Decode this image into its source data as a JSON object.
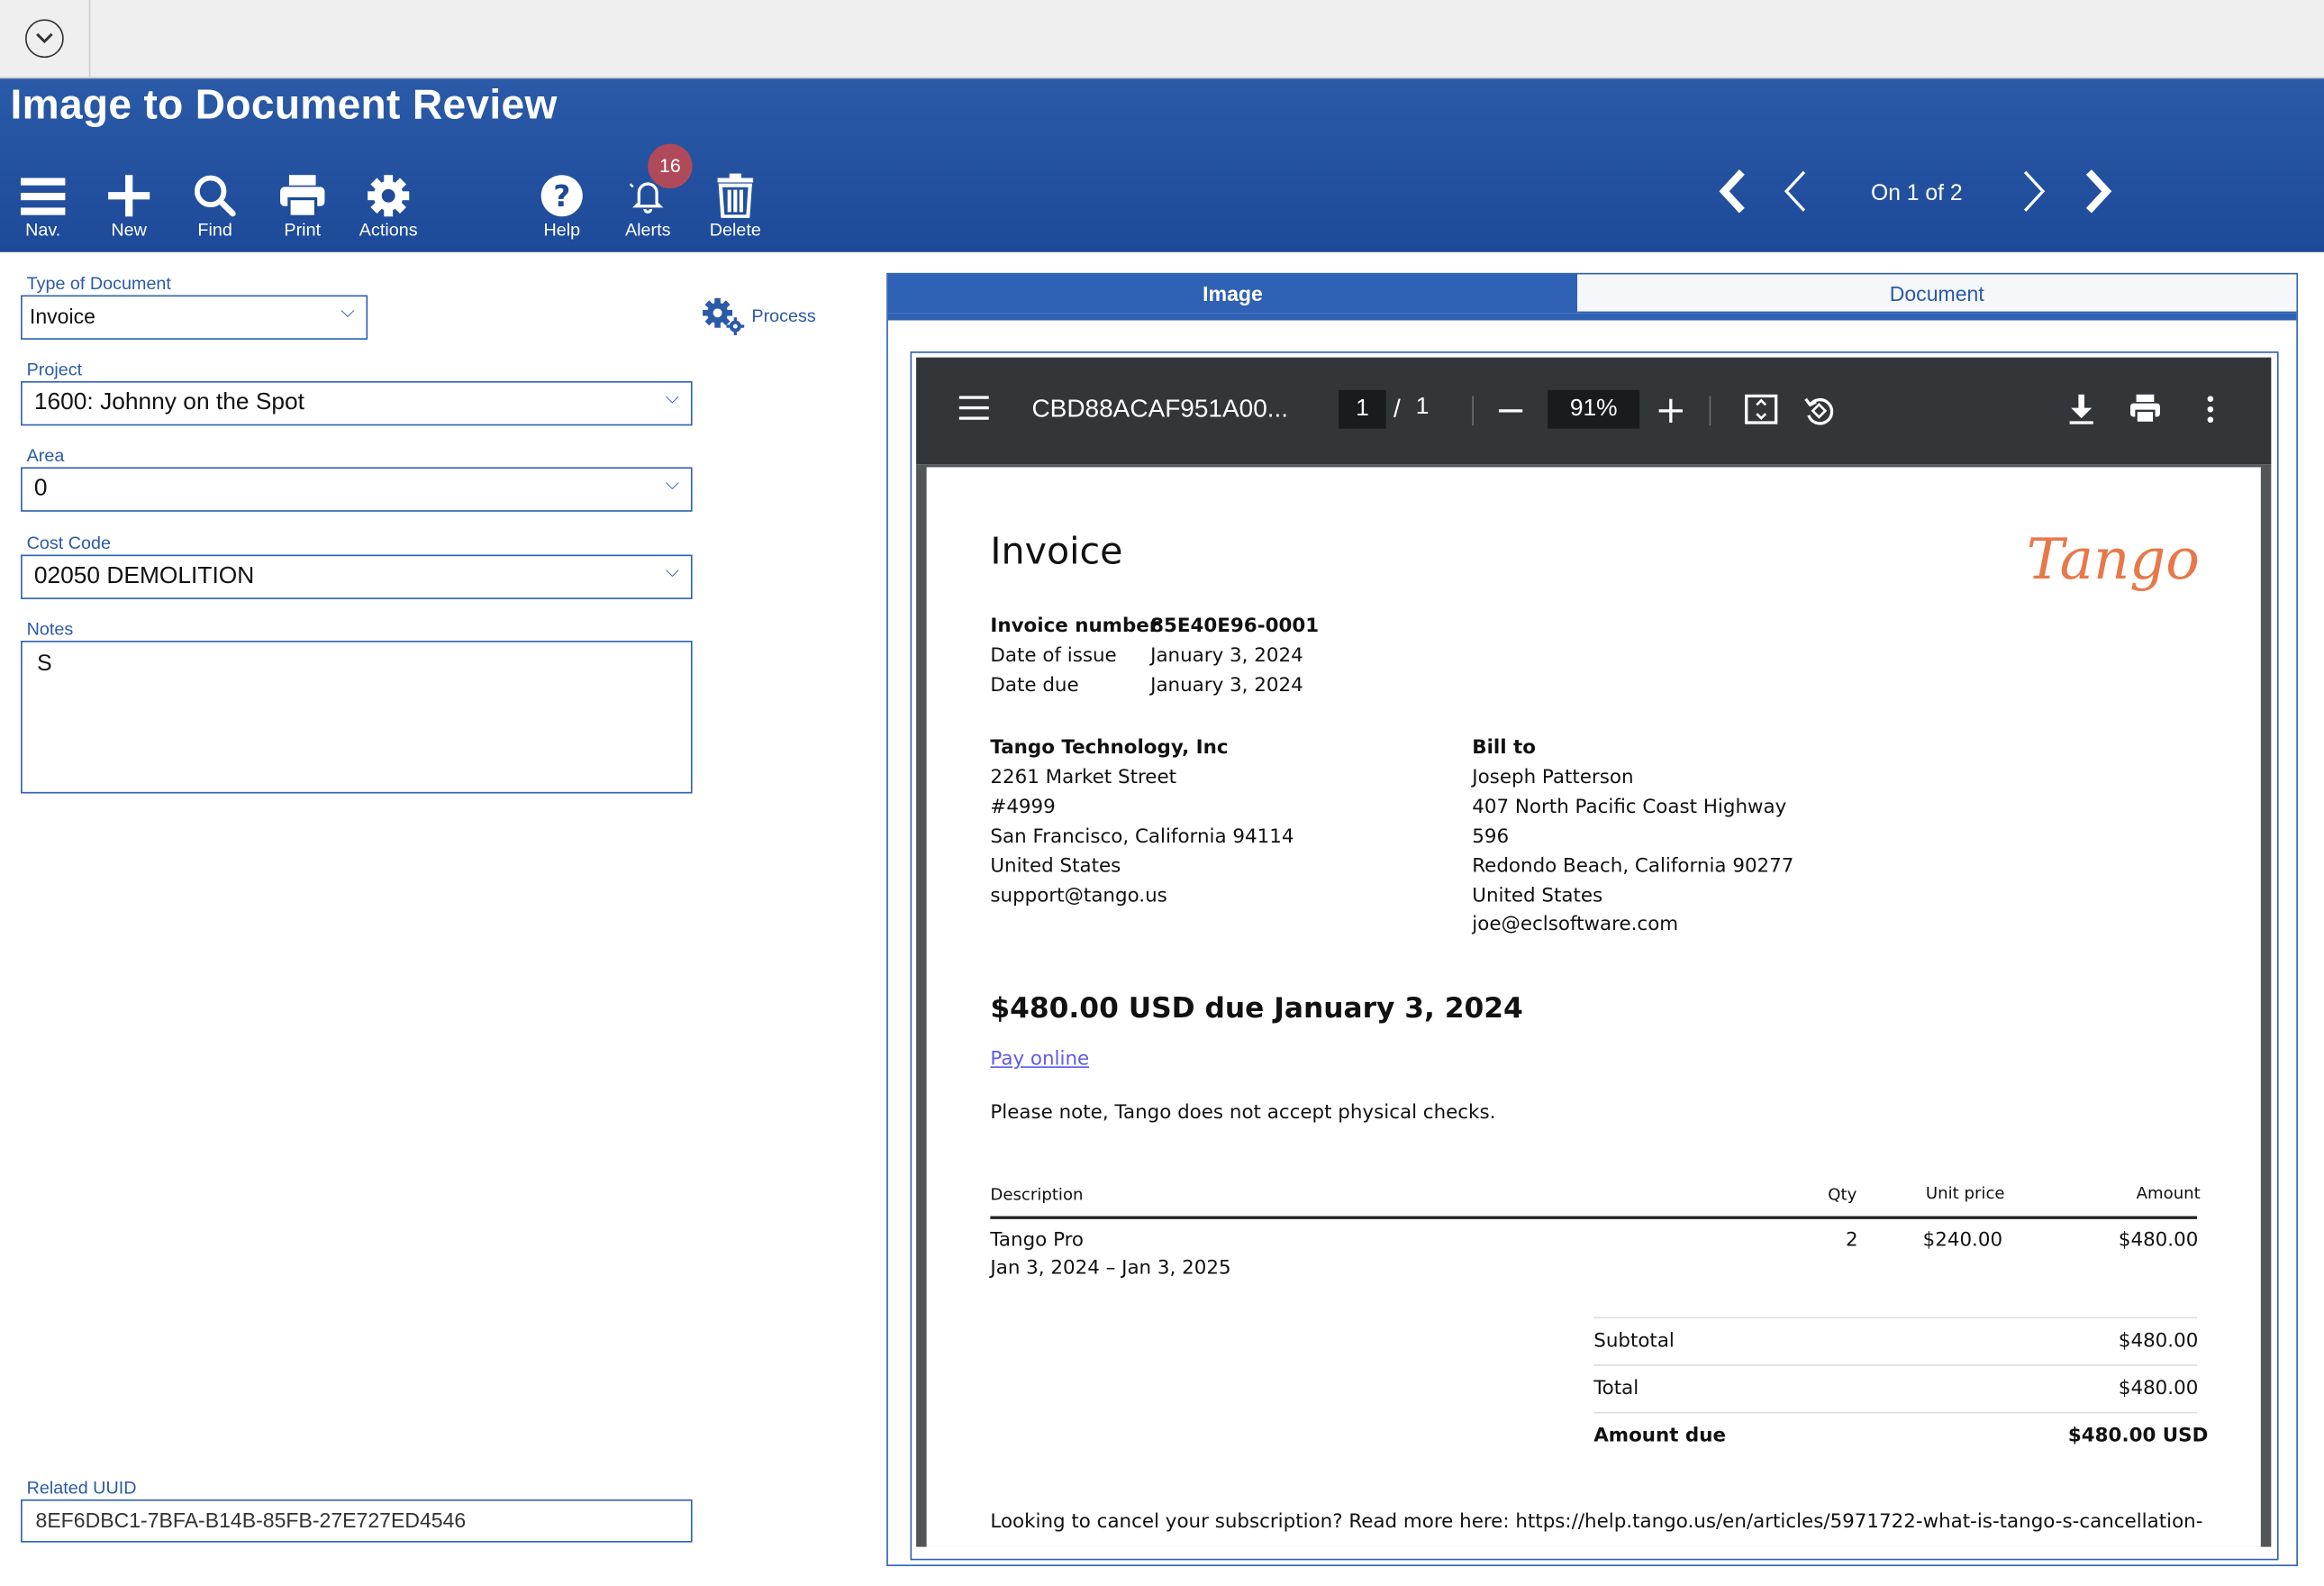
{
  "app": {
    "title": "Image to Document Review"
  },
  "toolbar": {
    "nav": "Nav.",
    "new": "New",
    "find": "Find",
    "print": "Print",
    "actions": "Actions",
    "help": "Help",
    "alerts": "Alerts",
    "delete": "Delete",
    "alerts_count": "16"
  },
  "pager": {
    "text": "On 1 of 2"
  },
  "form": {
    "type_label": "Type of Document",
    "type_value": "Invoice",
    "process_label": "Process",
    "project_label": "Project",
    "project_value": "1600: Johnny on the Spot",
    "area_label": "Area",
    "area_value": "0",
    "cost_label": "Cost Code",
    "cost_value": "02050 DEMOLITION",
    "notes_label": "Notes",
    "notes_value": "S",
    "uuid_label": "Related UUID",
    "uuid_value": "8EF6DBC1-7BFA-B14B-85FB-27E727ED4546"
  },
  "tabs": {
    "image": "Image",
    "document": "Document"
  },
  "viewer": {
    "filename": "CBD88ACAF951A00...",
    "page": "1",
    "sep": "/",
    "total": "1",
    "zoom": "91%"
  },
  "invoice": {
    "title": "Invoice",
    "logo": "Tango",
    "number_label": "Invoice number",
    "number": "85E40E96-0001",
    "issue_label": "Date of issue",
    "issue": "January 3, 2024",
    "due_label": "Date due",
    "due": "January 3, 2024",
    "from": [
      "Tango Technology, Inc",
      "2261 Market Street",
      "#4999",
      "San Francisco, California 94114",
      "United States",
      "support@tango.us"
    ],
    "bill_to": [
      "Bill to",
      "Joseph Patterson",
      "407 North Pacific Coast Highway",
      "596",
      "Redondo Beach, California 90277",
      "United States",
      "joe@eclsoftware.com"
    ],
    "amount_due_heading": "$480.00 USD due January 3, 2024",
    "pay_online": "Pay online",
    "note": "Please note, Tango does not accept physical checks.",
    "table": {
      "headers": [
        "Description",
        "Qty",
        "Unit price",
        "Amount"
      ],
      "row": {
        "desc": "Tango Pro",
        "period": "Jan 3, 2024 – Jan 3, 2025",
        "qty": "2",
        "unit": "$240.00",
        "amount": "$480.00"
      }
    },
    "subtotal_label": "Subtotal",
    "subtotal": "$480.00",
    "total_label": "Total",
    "total": "$480.00",
    "amount_due_label": "Amount due",
    "amount_due": "$480.00 USD",
    "cancel_note": "Looking to cancel your subscription? Read more here: https://help.tango.us/en/articles/5971722-what-is-tango-s-cancellation-"
  }
}
